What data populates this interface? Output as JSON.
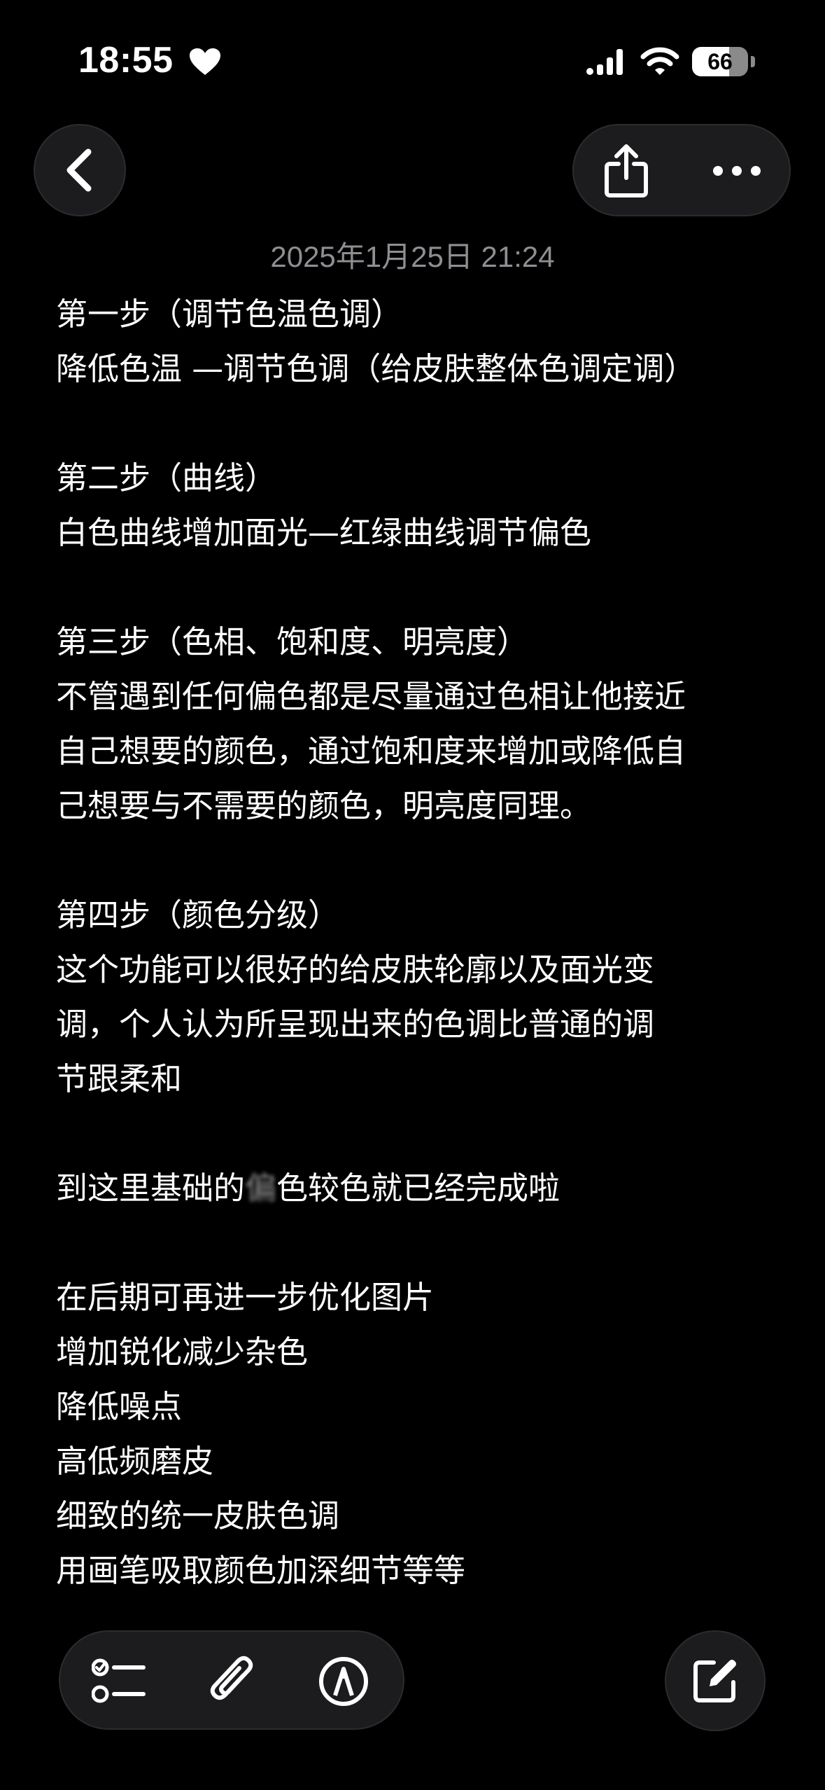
{
  "status_bar": {
    "time": "18:55",
    "battery_level": "66",
    "battery_fraction": 0.66
  },
  "icons": {
    "status": [
      "heart-icon",
      "cellular-signal-icon",
      "wifi-icon",
      "battery-icon"
    ],
    "navigation": [
      "chevron-left-icon",
      "share-icon",
      "more-icon"
    ],
    "toolbar": [
      "checklist-icon",
      "paperclip-icon",
      "markup-pen-icon",
      "compose-icon"
    ]
  },
  "colors": {
    "background": "#000000",
    "button_fill": "#1c1c1e",
    "date_text": "#8e8e93",
    "body_text": "#ffffff"
  },
  "note": {
    "date": "2025年1月25日 21:24",
    "lines": [
      "第一步（调节色温色调）",
      "降低色温 —调节色调（给皮肤整体色调定调）",
      "",
      "第二步（曲线）",
      "白色曲线增加面光—红绿曲线调节偏色",
      "",
      "第三步（色相、饱和度、明亮度）",
      "不管遇到任何偏色都是尽量通过色相让他接近",
      "自己想要的颜色，通过饱和度来增加或降低自",
      "己想要与不需要的颜色，明亮度同理。",
      "",
      "第四步（颜色分级）",
      "这个功能可以很好的给皮肤轮廓以及面光变",
      "调，个人认为所呈现出来的色调比普通的调",
      "节跟柔和",
      "",
      "",
      "",
      "在后期可再进一步优化图片",
      "增加锐化减少杂色",
      "降低噪点",
      "高低频磨皮",
      "细致的统一皮肤色调",
      "用画笔吸取颜色加深细节等等"
    ],
    "partial_line": {
      "before": "到这里基础的",
      "obscured": "偏",
      "after": "色较色就已经完成啦"
    }
  }
}
